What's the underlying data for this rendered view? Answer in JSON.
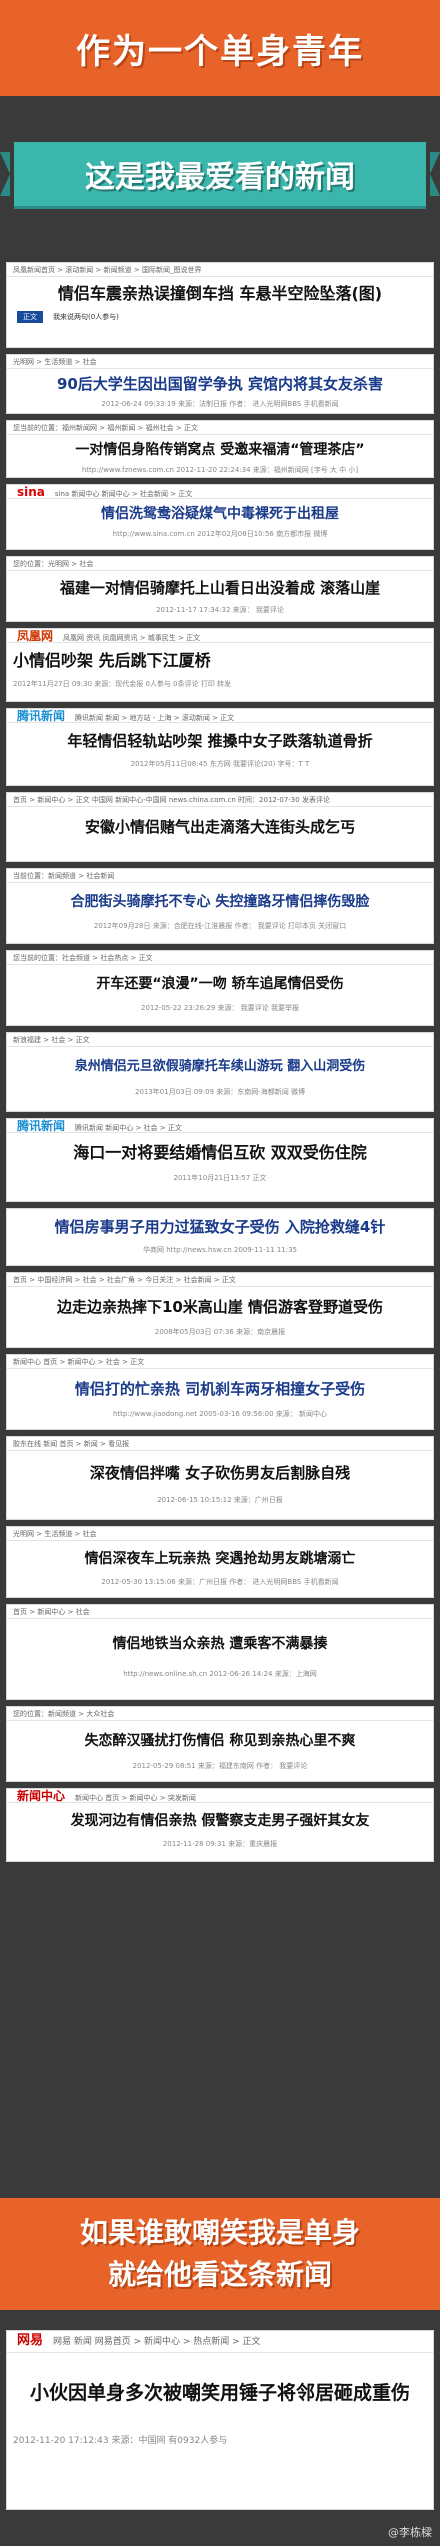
{
  "header": {
    "title": "作为一个单身青年"
  },
  "ribbon": {
    "title": "这是我最爱看的新闻"
  },
  "cards": [
    {
      "crumb": "凤凰新闻首页 > 滚动新闻 > 新闻频道 > 国际新闻_图说世界",
      "headline": "情侣车震亲热误撞倒车挡  车悬半空险坠落(图)",
      "tabs": [
        "正文",
        "我来说两句(0人参与)"
      ]
    },
    {
      "crumb": "光明网 > 生活频道 > 社会",
      "headline": "90后大学生因出国留学争执  宾馆内将其女友杀害",
      "meta": "2012-06-24 09:33:19  来源：法制日报  作者：  进入光明网BBS  手机看新闻"
    },
    {
      "crumb": "您当前的位置：福州新闻网 > 福州新闻 > 福州社会 > 正文",
      "headline": "一对情侣身陷传销窝点  受邀来福清“管理茶店”",
      "meta": "http://www.fznews.com.cn  2012-11-20 22:24:34  来源：福州新闻网  [字号 大 中 小]"
    },
    {
      "crumb": "sina 新闻中心  新闻中心 > 社会新闻 > 正文",
      "headline": "情侣洗鸳鸯浴疑煤气中毒裸死于出租屋",
      "meta": "http://www.sina.com.cn  2012年02月08日10:56  南方都市报  微博"
    },
    {
      "crumb": "您的位置：光明网 > 社会",
      "headline": "福建一对情侣骑摩托上山看日出没着成  滚落山崖",
      "meta": "2012-11-17 17:34:32  来源：  我要评论"
    },
    {
      "crumb": "凤凰网 资讯  凤凰网资讯 > 城事民生 > 正文",
      "headline": "小情侣吵架  先后跳下江厦桥",
      "meta": "2012年11月27日 09:30  来源：现代金报  0人参与  0条评论  打印  转发"
    },
    {
      "crumb": "腾讯新闻  新闻 > 地方站 - 上海 > 滚动新闻 > 正文",
      "headline": "年轻情侣轻轨站吵架  推搡中女子跌落轨道骨折",
      "meta": "2012年05月11日08:45  东方网  我要评论(20)  字号：T T"
    },
    {
      "crumb": "首页 > 新闻中心 > 正文  中国网  新闻中心-中国网  news.china.com.cn  时间：2012-07-30  发表评论",
      "headline": "安徽小情侣赌气出走滴落大连街头成乞丐",
      "meta": ""
    },
    {
      "crumb": "当前位置：新闻频道 > 社会新闻",
      "headline": "合肥街头骑摩托不专心  失控撞路牙情侣摔伤毁脸",
      "meta": "2012年09月28日  来源：合肥在线-江淮晨报  作者：  我要评论  打印本页  关闭窗口"
    },
    {
      "crumb": "您当前的位置：社会频道 > 社会热点 > 正文",
      "headline": "开车还要“浪漫”一吻  轿车追尾情侣受伤",
      "meta": "2012-05-22 23:26:29  来源：  我要评论  我要举报"
    },
    {
      "crumb": "新浪福建 > 社会 > 正文",
      "headline": "泉州情侣元旦欲假骑摩托车续山游玩  翻入山洞受伤",
      "meta": "2013年01月03日 09:09  来源：东南网-海都新闻  微博"
    },
    {
      "crumb": "腾讯新闻  新闻中心 > 社会 > 正文",
      "headline": "海口一对将要结婚情侣互砍  双双受伤住院",
      "meta": "2011年10月21日13:57  正文"
    },
    {
      "crumb": "",
      "headline": "情侣房事男子用力过猛致女子受伤  入院抢救缝4针",
      "meta": "华商网 http://news.hsw.cn  2009-11-11 11:35"
    },
    {
      "crumb": "首页 > 中国经济网 > 社会 > 社会广角 > 今日关注 > 社会新闻 > 正文",
      "headline": "边走边亲热摔下10米高山崖  情侣游客登野道受伤",
      "meta": "2008年05月03日 07:36  来源：南京晨报"
    },
    {
      "crumb": "新闻中心  首页 > 新闻中心 > 社会 > 正文",
      "headline": "情侣打的忙亲热  司机刹车两牙相撞女子受伤",
      "meta": "http://www.jiaodong.net 2005-03-16 09:56:00  来源：  新闻中心"
    },
    {
      "crumb": "胶东在线 新闻  首页 > 新闻 > 看见报",
      "headline": "深夜情侣拌嘴  女子砍伤男友后割脉自残",
      "meta": "2012-06-15 10:15:12  来源：广州日报"
    },
    {
      "crumb": "光明网 > 生活频道 > 社会",
      "headline": "情侣深夜车上玩亲热  突遇抢劫男友跳塘溺亡",
      "meta": "2012-05-30 13:15:06  来源：广州日报  作者：  进入光明网BBS  手机看新闻"
    },
    {
      "crumb": "首页 > 新闻中心 > 社会",
      "headline": "情侣地铁当众亲热  遭乘客不满暴揍",
      "meta": "http://news.online.sh.cn  2012-06-26 14:24  来源：上海网"
    },
    {
      "crumb": "您的位置：新闻频道 > 大众社会",
      "headline": "失恋醉汉骚扰打伤情侣  称见到亲热心里不爽",
      "meta": "2012-05-29 08:51  来源：福建东南网  作者：  我要评论"
    },
    {
      "crumb": "新闻中心  首页 > 新闻中心 > 突发新闻",
      "headline": "发现河边有情侣亲热  假警察支走男子强奸其女友",
      "meta": "2012-11-28 09:31  来源：重庆晨报"
    }
  ],
  "bottom": {
    "line1": "如果谁敢嘲笑我是单身",
    "line2": "就给他看这条新闻"
  },
  "final_card": {
    "crumb": "网易 新闻  网易首页 > 新闻中心 > 热点新闻 > 正文",
    "headline": "小伙因单身多次被嘲笑用锤子将邻居砸成重伤",
    "meta": "2012-11-20 17:12:43  来源：中国网  有0932人参与"
  },
  "watermark": "@李栋樑"
}
